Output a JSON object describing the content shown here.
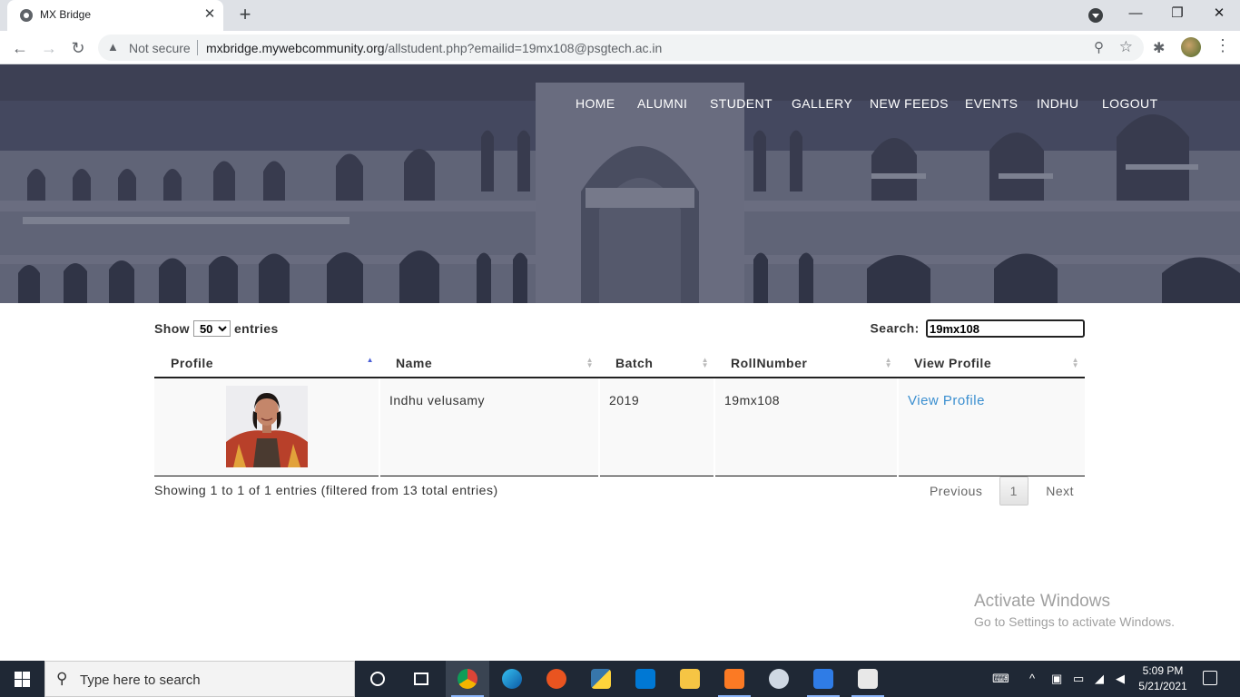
{
  "browser": {
    "tab_title": "MX Bridge",
    "not_secure": "Not secure",
    "url_host": "mxbridge.mywebcommunity.org",
    "url_path": "/allstudent.php?emailid=19mx108@psgtech.ac.in"
  },
  "nav": {
    "items": [
      "HOME",
      "ALUMNI",
      "STUDENT",
      "GALLERY",
      "NEW FEEDS",
      "EVENTS",
      "INDHU",
      "LOGOUT"
    ]
  },
  "table_controls": {
    "show_label": "Show",
    "entries_label": "entries",
    "page_length": "50",
    "search_label": "Search:",
    "search_value": "19mx108"
  },
  "table": {
    "headers": [
      "Profile",
      "Name",
      "Batch",
      "RollNumber",
      "View Profile"
    ],
    "rows": [
      {
        "name": "Indhu velusamy",
        "batch": "2019",
        "roll": "19mx108",
        "link": "View Profile"
      }
    ]
  },
  "footer": {
    "info": "Showing 1 to 1 of 1 entries (filtered from 13 total entries)",
    "previous": "Previous",
    "current_page": "1",
    "next": "Next"
  },
  "watermark": {
    "line1": "Activate Windows",
    "line2": "Go to Settings to activate Windows."
  },
  "taskbar": {
    "search_placeholder": "Type here to search",
    "time": "5:09 PM",
    "date": "5/21/2021"
  }
}
